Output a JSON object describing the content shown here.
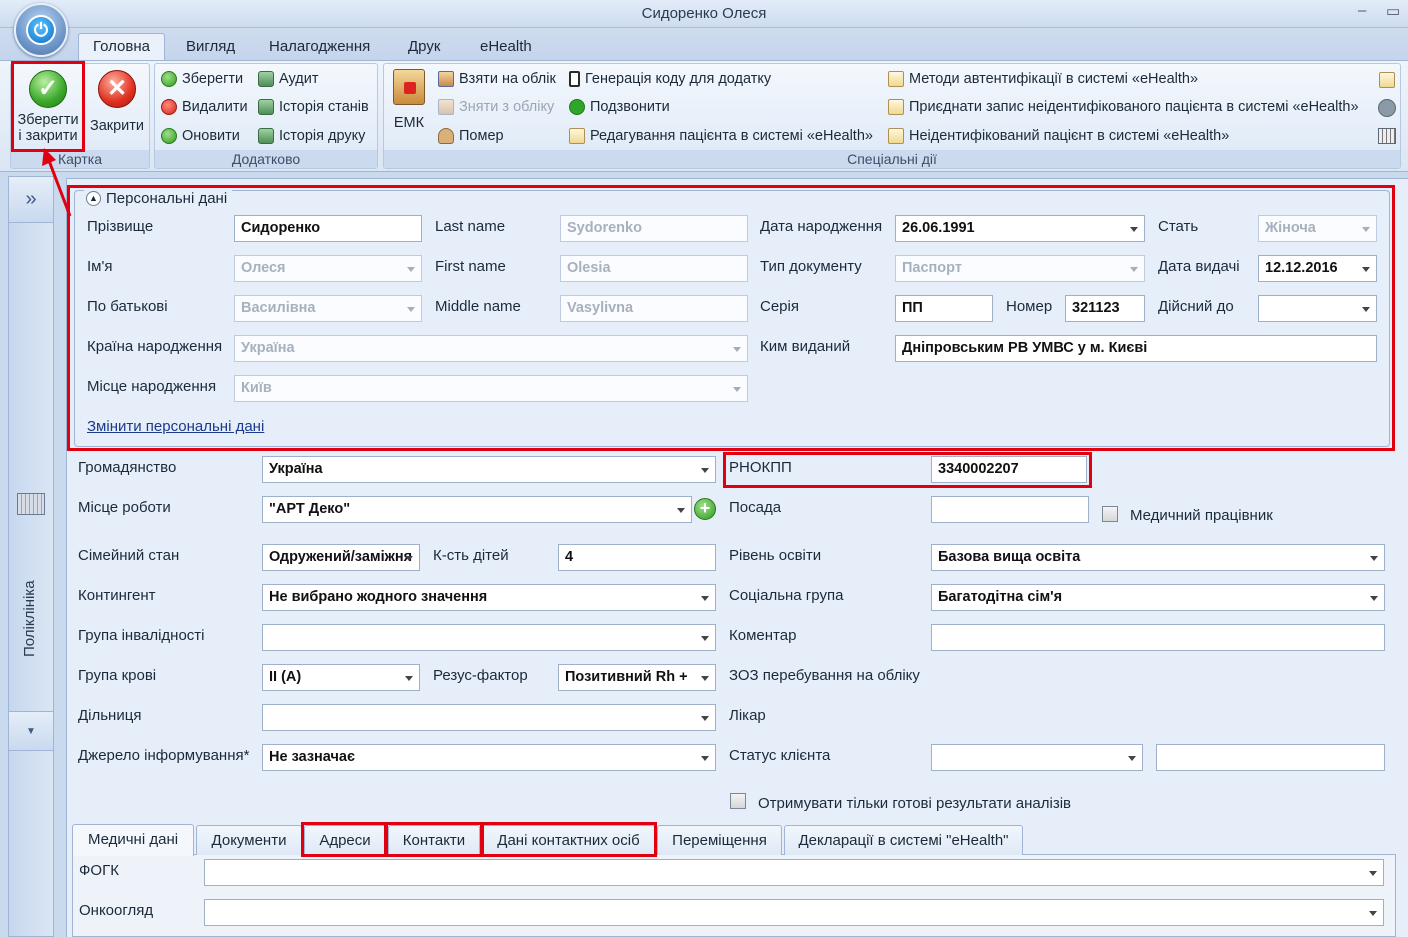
{
  "window": {
    "title": "Сидоренко Олеся",
    "minimize": "‒",
    "maximize": "▭"
  },
  "ribbon_tabs": [
    "Головна",
    "Вигляд",
    "Налагодження",
    "Друк",
    "eHealth"
  ],
  "groups": {
    "card": {
      "label": "Картка",
      "save_close_line1": "Зберегти",
      "save_close_line2": "і закрити",
      "close": "Закрити"
    },
    "extra": {
      "label": "Додатково",
      "save": "Зберегти",
      "delete": "Видалити",
      "refresh": "Оновити",
      "audit": "Аудит",
      "state_history": "Історія станів",
      "print_history": "Історія друку"
    },
    "special": {
      "label": "Спеціальні дії",
      "emk": "ЕМК",
      "register": "Взяти на облік",
      "unregister": "Зняти з обліку",
      "death": "Помер",
      "gen_code": "Генерація коду для додатку",
      "call": "Подзвонити",
      "edit_patient": "Редагування пацієнта в системі «eHealth»",
      "auth_methods": "Методи автентифікації в системі «eHealth»",
      "attach_record": "Приєднати запис неідентифікованого пацієнта в системі «eHealth»",
      "unidentified": "Неідентифікований пацієнт в системі «eHealth»"
    }
  },
  "sidebar": {
    "expand": "»",
    "label": "Поліклініка"
  },
  "personal": {
    "legend": "Персональні дані",
    "surname_label": "Прізвище",
    "surname": "Сидоренко",
    "lastname_label": "Last name",
    "lastname": "Sydorenko",
    "birthdate_label": "Дата народження",
    "birthdate": "26.06.1991",
    "sex_label": "Стать",
    "sex": "Жіноча",
    "name_label": "Ім'я",
    "name": "Олеся",
    "firstname_label": "First name",
    "firstname": "Olesia",
    "doctype_label": "Тип документу",
    "doctype": "Паспорт",
    "issue_date_label": "Дата видачі",
    "issue_date": "12.12.2016",
    "patronymic_label": "По батькові",
    "patronymic": "Василівна",
    "middlename_label": "Middle name",
    "middlename": "Vasylivna",
    "series_label": "Серія",
    "series": "ПП",
    "number_label": "Номер",
    "number": "321123",
    "valid_until_label": "Дійсний до",
    "valid_until": "",
    "birth_country_label": "Країна народження",
    "birth_country": "Україна",
    "issued_by_label": "Ким виданий",
    "issued_by": "Дніпровським РВ УМВС  у м. Києві",
    "birth_place_label": "Місце народження",
    "birth_place": "Київ",
    "change_link": "Змінити персональні дані"
  },
  "form": {
    "citizenship_label": "Громадянство",
    "citizenship": "Україна",
    "rnokpp_label": "РНОКПП",
    "rnokpp": "3340002207",
    "workplace_label": "Місце роботи",
    "workplace": "\"АРТ Деко\"",
    "position_label": "Посада",
    "position": "",
    "medic_label": "Медичний працівник",
    "marital_label": "Сімейний стан",
    "marital": "Одружений/заміжня",
    "children_label": "К-сть дітей",
    "children": "4",
    "education_label": "Рівень освіти",
    "education": "Базова вища освіта",
    "contingent_label": "Контингент",
    "contingent": "Не вибрано жодного значення",
    "social_label": "Соціальна група",
    "social": "Багатодітна сім'я",
    "disability_label": "Група інвалідності",
    "disability": "",
    "comment_label": "Коментар",
    "comment": "",
    "blood_label": "Група крові",
    "blood": "II (A)",
    "rh_label": "Резус-фактор",
    "rh": "Позитивний Rh +",
    "zoz_label": "ЗОЗ перебування на обліку",
    "district_label": "Дільниця",
    "district": "",
    "doctor_label": "Лікар",
    "source_label": "Джерело інформування*",
    "source": "Не зазначає",
    "status_label": "Статус клієнта",
    "status": "",
    "status_extra": "",
    "ready_results_label": "Отримувати тільки готові результати аналізів"
  },
  "bottom_tabs": [
    "Медичні дані",
    "Документи",
    "Адреси",
    "Контакти",
    "Дані контактних осіб",
    "Переміщення",
    "Декларації в системі \"eHealth\""
  ],
  "medical": {
    "fogk_label": "ФОГК",
    "fogk": "",
    "onco_label": "Онкоогляд",
    "onco": ""
  }
}
